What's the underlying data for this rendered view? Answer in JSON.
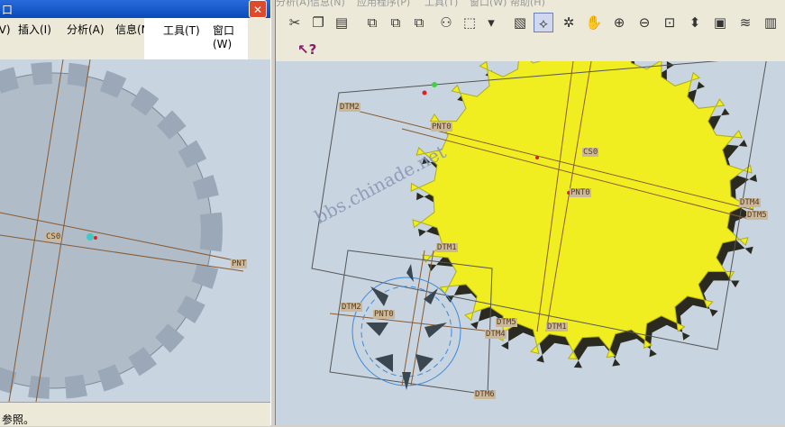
{
  "left_window": {
    "title": "口",
    "close_glyph": "✕",
    "menu": [
      "视图(V)",
      "插入(I)",
      "分析(A)",
      "信息(N)",
      "工具(T)",
      "窗口(W)"
    ],
    "status_text": "参照。"
  },
  "right_window": {
    "menu_fragments": [
      "分析(A)",
      "信息(N)",
      "应用程序(P)",
      "工具(T)",
      "窗口(W)",
      "帮助(H)"
    ],
    "toolbar_icons": [
      "scissors-icon",
      "copy-icon",
      "paste-icon",
      "regen-icon",
      "find-icon",
      "select-icon",
      "dropdown-icon",
      "sketch-icon",
      "datum-point-icon",
      "spin-icon",
      "pan-icon",
      "zoom-in-icon",
      "zoom-out-icon",
      "zoom-fit-icon",
      "orient-icon",
      "layers-icon"
    ],
    "help_icon": "?"
  },
  "datum_labels_right": [
    "DTM2",
    "PNT0",
    "CS0",
    "PNT0",
    "DTM4",
    "DTM5",
    "DTM1",
    "DTM2",
    "PNT0",
    "DTM5",
    "DTM4",
    "DTM1",
    "DTM6"
  ],
  "datum_labels_left": [
    "CS0",
    "PNT"
  ],
  "watermark": "bbs.chinade.net",
  "colors": {
    "gear_yellow": "#f0ee20",
    "gear_grey": "#b0bcc8",
    "datum_line": "#8a5a30",
    "viewport_bg": "#c8d4e0"
  }
}
